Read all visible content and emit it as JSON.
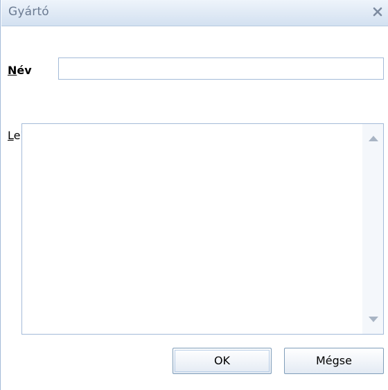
{
  "dialog": {
    "title": "Gyártó"
  },
  "form": {
    "name_label": "Név",
    "name_value": "",
    "description_label": "Leírás",
    "description_value": ""
  },
  "buttons": {
    "ok_label": "OK",
    "cancel_label": "Mégse"
  },
  "icons": {
    "close": "close-icon",
    "scroll_up": "scroll-up-arrow-icon",
    "scroll_down": "scroll-down-arrow-icon"
  }
}
